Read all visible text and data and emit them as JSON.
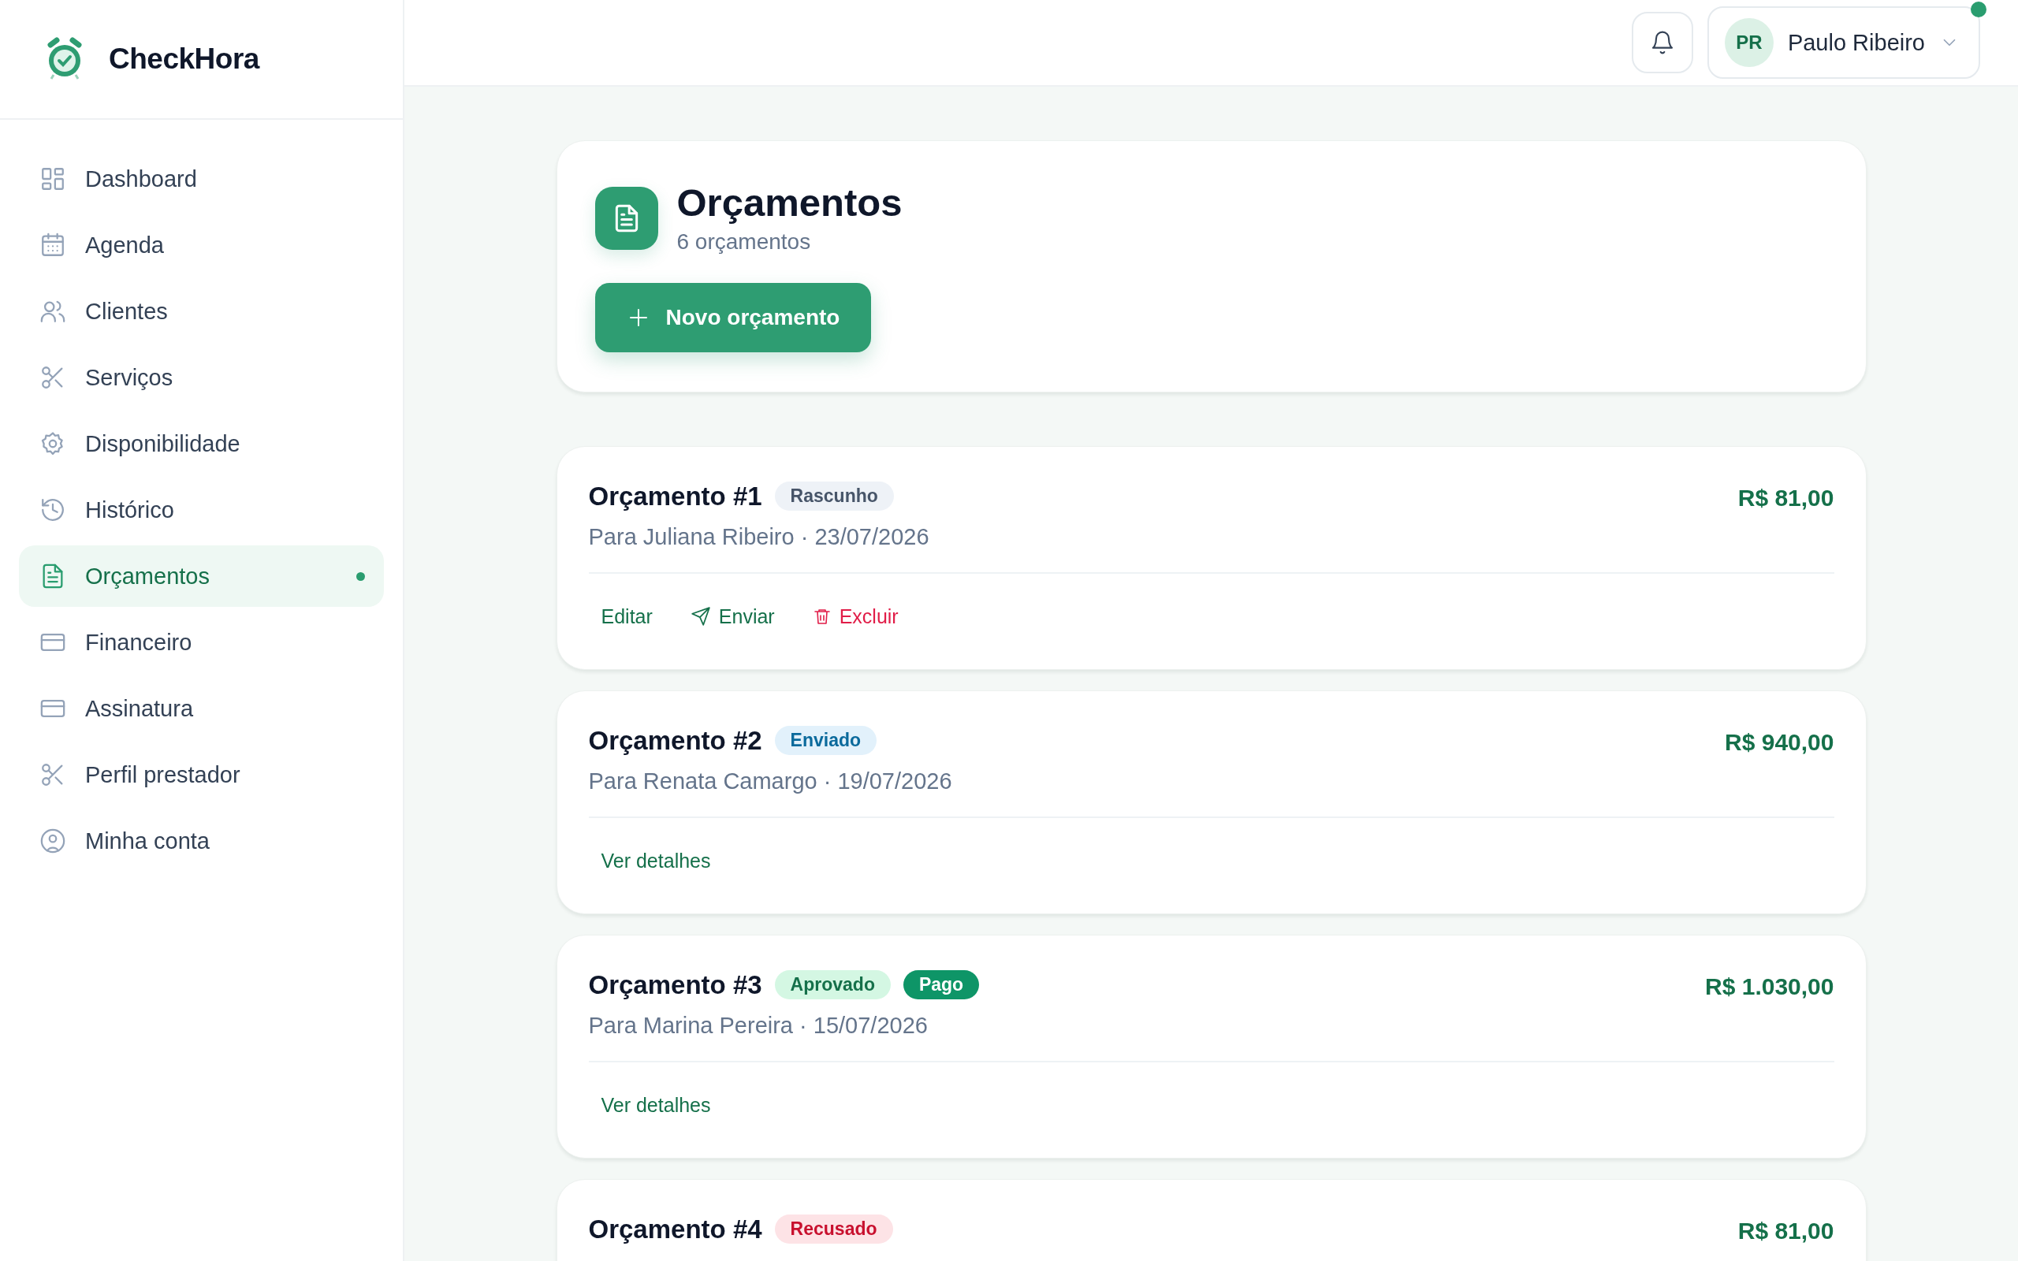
{
  "brand": {
    "name": "CheckHora"
  },
  "sidebar": {
    "items": [
      {
        "label": "Dashboard",
        "selected": false
      },
      {
        "label": "Agenda",
        "selected": false
      },
      {
        "label": "Clientes",
        "selected": false
      },
      {
        "label": "Serviços",
        "selected": false
      },
      {
        "label": "Disponibilidade",
        "selected": false
      },
      {
        "label": "Histórico",
        "selected": false
      },
      {
        "label": "Orçamentos",
        "selected": true
      },
      {
        "label": "Financeiro",
        "selected": false
      },
      {
        "label": "Assinatura",
        "selected": false
      },
      {
        "label": "Perfil prestador",
        "selected": false
      },
      {
        "label": "Minha conta",
        "selected": false
      }
    ]
  },
  "topbar": {
    "user": {
      "initials": "PR",
      "name": "Paulo Ribeiro",
      "online": true
    }
  },
  "page": {
    "title": "Orçamentos",
    "subtitle": "6 orçamentos",
    "new_button": "Novo orçamento"
  },
  "quotes": [
    {
      "title": "Orçamento #1",
      "badges": [
        {
          "label": "Rascunho",
          "kind": "draft"
        }
      ],
      "amount": "R$ 81,00",
      "subtitle": "Para Juliana Ribeiro · 23/07/2026",
      "actions": [
        {
          "label": "Editar",
          "kind": "edit"
        },
        {
          "label": "Enviar",
          "kind": "send"
        },
        {
          "label": "Excluir",
          "kind": "delete"
        }
      ]
    },
    {
      "title": "Orçamento #2",
      "badges": [
        {
          "label": "Enviado",
          "kind": "sent"
        }
      ],
      "amount": "R$ 940,00",
      "subtitle": "Para Renata Camargo · 19/07/2026",
      "actions": [
        {
          "label": "Ver detalhes",
          "kind": "details"
        }
      ]
    },
    {
      "title": "Orçamento #3",
      "badges": [
        {
          "label": "Aprovado",
          "kind": "approved"
        },
        {
          "label": "Pago",
          "kind": "paid"
        }
      ],
      "amount": "R$ 1.030,00",
      "subtitle": "Para Marina Pereira · 15/07/2026",
      "actions": [
        {
          "label": "Ver detalhes",
          "kind": "details"
        }
      ]
    },
    {
      "title": "Orçamento #4",
      "badges": [
        {
          "label": "Recusado",
          "kind": "refused"
        }
      ],
      "amount": "R$ 81,00"
    }
  ]
}
